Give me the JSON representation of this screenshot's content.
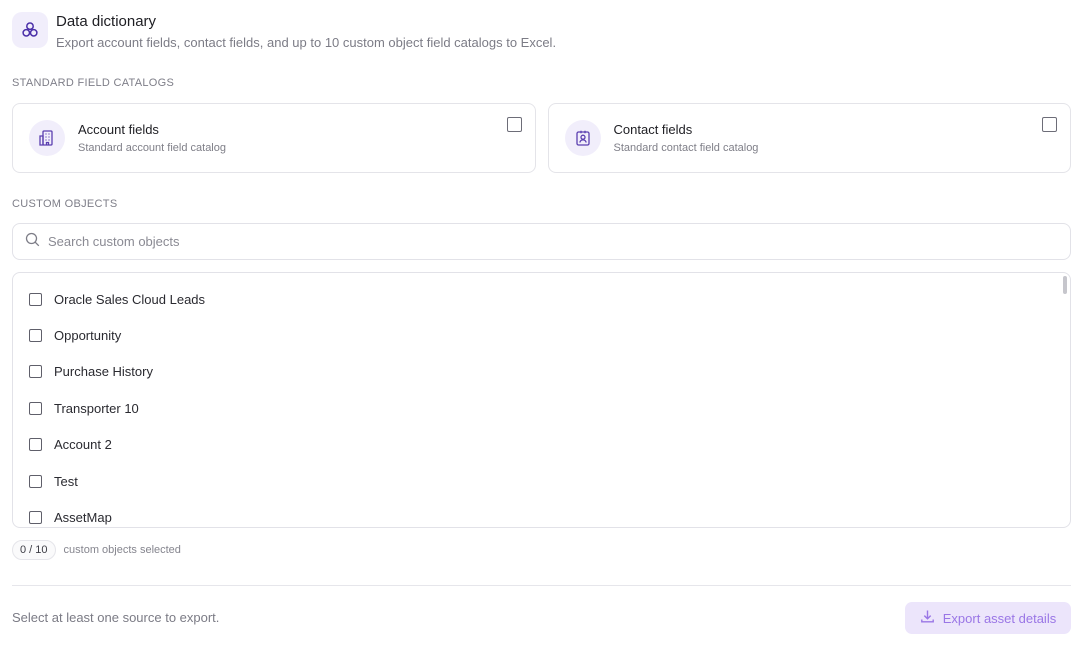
{
  "header": {
    "icon": "cubes-icon",
    "title": "Data dictionary",
    "subtitle": "Export account fields, contact fields, and up to 10 custom object field catalogs to Excel."
  },
  "standard": {
    "section_label": "STANDARD FIELD CATALOGS",
    "cards": [
      {
        "icon": "building-icon",
        "title": "Account fields",
        "subtitle": "Standard account field catalog",
        "checked": false
      },
      {
        "icon": "contact-card-icon",
        "title": "Contact fields",
        "subtitle": "Standard contact field catalog",
        "checked": false
      }
    ]
  },
  "custom": {
    "section_label": "CUSTOM OBJECTS",
    "search_placeholder": "Search custom objects",
    "items": [
      "Oracle Sales Cloud Leads",
      "Opportunity",
      "Purchase History",
      "Transporter 10",
      "Account 2",
      "Test",
      "AssetMap"
    ],
    "count_badge": "0 / 10",
    "count_text": "custom objects selected"
  },
  "footer": {
    "hint": "Select at least one source to export.",
    "export_label": "Export asset details",
    "export_icon": "download-icon"
  },
  "colors": {
    "accent": "#9a76e6",
    "accent_bg": "#ece5fb",
    "icon_bg": "#f1eefb",
    "icon_stroke": "#5b3fb0"
  }
}
